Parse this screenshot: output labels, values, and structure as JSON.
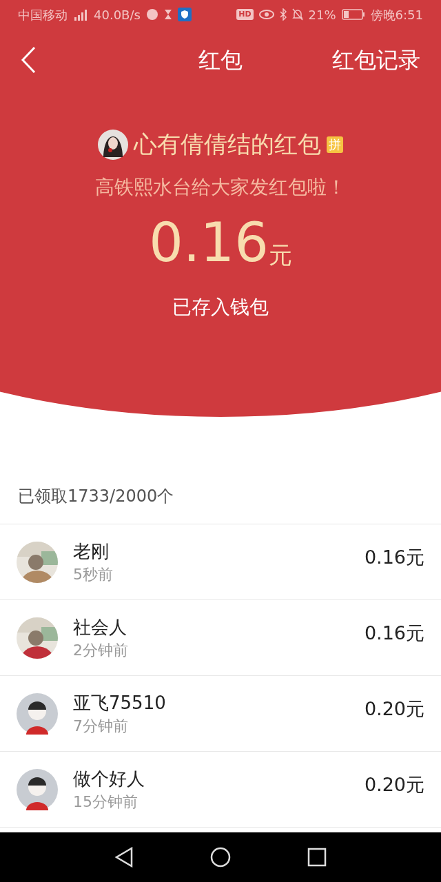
{
  "status_bar": {
    "carrier": "中国移动",
    "network_speed": "40.0B/s",
    "hd": "HD",
    "battery": "21%",
    "time": "傍晚6:51"
  },
  "nav": {
    "title": "红包",
    "action": "红包记录"
  },
  "packet": {
    "sender": "心有倩倩结的红包",
    "tag": "拼",
    "message": "高铁熙水台给大家发红包啦！",
    "amount": "0.16",
    "unit": "元",
    "status": "已存入钱包"
  },
  "summary": "已领取1733/2000个",
  "claims": [
    {
      "name": "老刚",
      "time": "5秒前",
      "amount": "0.16元"
    },
    {
      "name": "社会人",
      "time": "2分钟前",
      "amount": "0.16元"
    },
    {
      "name": "亚飞75510",
      "time": "7分钟前",
      "amount": "0.20元",
      "avatar": {
        "kind": "default",
        "color": "#c8ccd2"
      }
    },
    {
      "name": "做个好人",
      "time": "15分钟前",
      "amount": "0.20元",
      "avatar": {
        "kind": "default",
        "color": "#c8ccd2"
      }
    }
  ]
}
